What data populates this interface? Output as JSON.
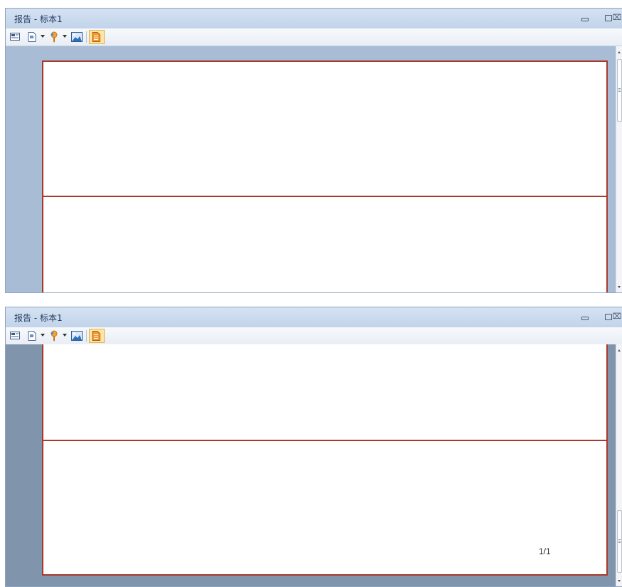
{
  "windows": [
    {
      "title": "报告 - 标本1",
      "page_number": "",
      "controls": {
        "minimize": "",
        "maximize": "",
        "close": "⌧"
      }
    },
    {
      "title": "报告 - 标本1",
      "page_number": "1/1",
      "controls": {
        "minimize": "",
        "maximize": "",
        "close": "⌧"
      }
    }
  ],
  "toolbar": {
    "items": [
      {
        "icon": "insert-textbox-icon"
      },
      {
        "icon": "insert-page-icon",
        "dropdown": true
      },
      {
        "icon": "insert-field-icon",
        "dropdown": true
      },
      {
        "icon": "insert-image-icon"
      },
      {
        "icon": "page-view-icon",
        "active": true
      }
    ]
  },
  "colors": {
    "band_border": "#a93a2a",
    "workspace_top": "#a8bcd6",
    "workspace_bottom": "#8095ac",
    "toolbar_active": "#fbe6a8"
  },
  "scroll_position": {
    "top_window": 0.0,
    "bottom_window": 1.0
  }
}
